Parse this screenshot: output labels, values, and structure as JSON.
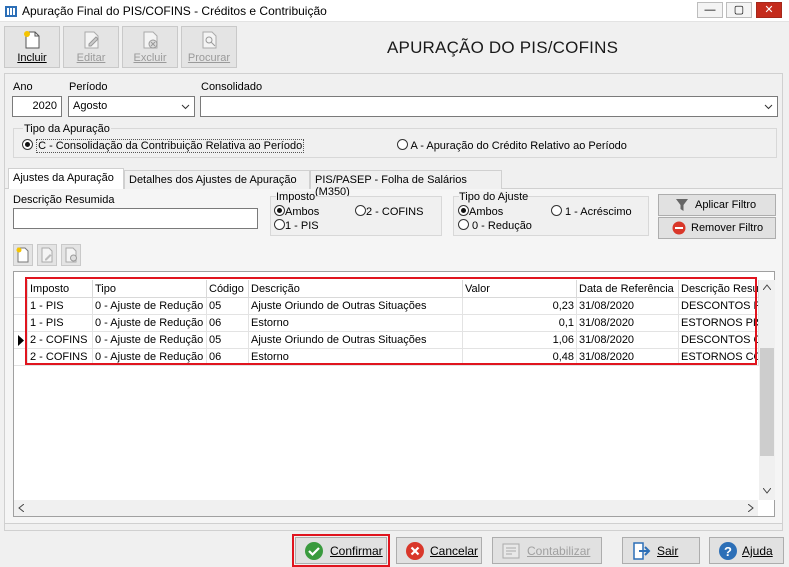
{
  "window": {
    "title": "Apuração Final do PIS/COFINS - Créditos e Contribuição",
    "min": "—",
    "max": "▢",
    "close": "✕"
  },
  "toolbar": {
    "incluir": "Incluir",
    "editar": "Editar",
    "excluir": "Excluir",
    "procurar": "Procurar"
  },
  "page_title": "APURAÇÃO DO PIS/COFINS",
  "filters": {
    "ano_label": "Ano",
    "ano_value": "2020",
    "periodo_label": "Período",
    "periodo_value": "Agosto",
    "consolidado_label": "Consolidado",
    "consolidado_value": ""
  },
  "tipo_apuracao": {
    "label": "Tipo da Apuração",
    "option_c": "C - Consolidação da Contribuição Relativa ao Período",
    "option_a": "A - Apuração do Crédito Relativo ao Período",
    "selected": "C"
  },
  "tabs": [
    {
      "label": "Ajustes da Apuração"
    },
    {
      "label": "Detalhes dos Ajustes de Apuração"
    },
    {
      "label": "PIS/PASEP - Folha de Salários (M350)"
    }
  ],
  "ajustes": {
    "descricao_label": "Descrição Resumida",
    "descricao_value": "",
    "imposto_label": "Imposto",
    "imposto_ambos": "Ambos",
    "imposto_cofins": "2 - COFINS",
    "imposto_pis": "1 - PIS",
    "tipo_label": "Tipo do Ajuste",
    "tipo_ambos": "Ambos",
    "tipo_acrescimo": "1 - Acréscimo",
    "tipo_reducao": "0 - Redução",
    "aplicar": "Aplicar Filtro",
    "remover": "Remover Filtro"
  },
  "table": {
    "columns": [
      "Imposto",
      "Tipo",
      "Código",
      "Descrição",
      "Valor",
      "Data de Referência",
      "Descrição Resu"
    ],
    "rows": [
      [
        "1 - PIS",
        "0 - Ajuste de Redução",
        "05",
        "Ajuste Oriundo de Outras Situações",
        "0,23",
        "31/08/2020",
        "DESCONTOS PI"
      ],
      [
        "1 - PIS",
        "0 - Ajuste de Redução",
        "06",
        "Estorno",
        "0,1",
        "31/08/2020",
        "ESTORNOS PIS"
      ],
      [
        "2 - COFINS",
        "0 - Ajuste de Redução",
        "05",
        "Ajuste Oriundo de Outras Situações",
        "1,06",
        "31/08/2020",
        "DESCONTOS CO"
      ],
      [
        "2 - COFINS",
        "0 - Ajuste de Redução",
        "06",
        "Estorno",
        "0,48",
        "31/08/2020",
        "ESTORNOS CO"
      ]
    ]
  },
  "footer": {
    "confirmar": "Confirmar",
    "cancelar": "Cancelar",
    "contabilizar": "Contabilizar",
    "sair": "Sair",
    "ajuda": "Ajuda"
  },
  "colors": {
    "highlight": "#e0141e",
    "close": "#c42b1c"
  }
}
